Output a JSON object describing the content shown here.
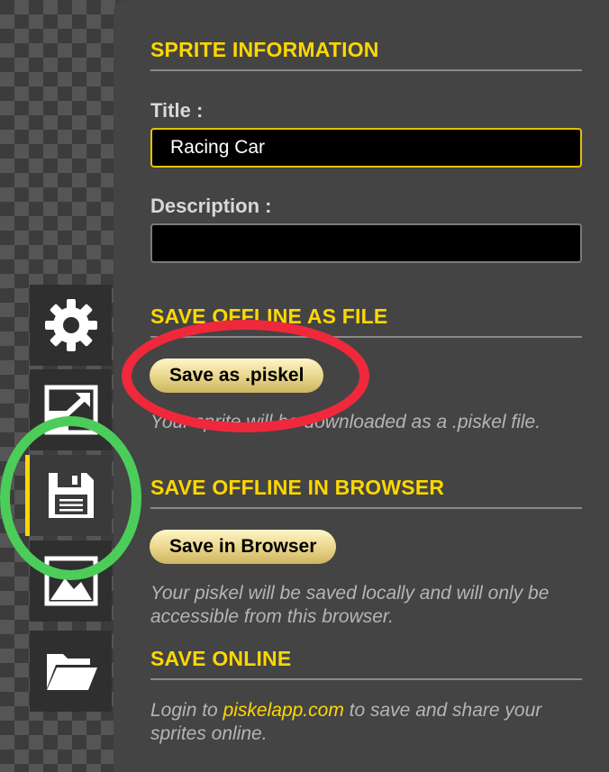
{
  "sprite_info": {
    "heading": "SPRITE INFORMATION",
    "title_label": "Title :",
    "title_value": "Racing Car",
    "description_label": "Description :",
    "description_value": ""
  },
  "save_file": {
    "heading": "SAVE OFFLINE AS FILE",
    "button": "Save as .piskel",
    "description": "Your sprite will be downloaded as a .piskel file."
  },
  "save_browser": {
    "heading": "SAVE OFFLINE IN BROWSER",
    "button": "Save in Browser",
    "description": "Your piskel will be saved locally and will only be accessible from this browser."
  },
  "save_online": {
    "heading": "SAVE ONLINE",
    "text_before": "Login to ",
    "link": "piskelapp.com",
    "text_after": " to save and share your sprites online."
  },
  "sidebar": {
    "items": [
      {
        "icon": "gear-icon",
        "selected": false
      },
      {
        "icon": "resize-icon",
        "selected": false
      },
      {
        "icon": "floppy-disk-icon",
        "selected": true
      },
      {
        "icon": "image-icon",
        "selected": false
      },
      {
        "icon": "folder-icon",
        "selected": false
      }
    ]
  },
  "annotations": {
    "red_circle_color": "#f0283c",
    "green_circle_color": "#4ccd5a"
  },
  "colors": {
    "accent": "#ffd700",
    "panel": "#444444",
    "button": "#e8d489"
  }
}
